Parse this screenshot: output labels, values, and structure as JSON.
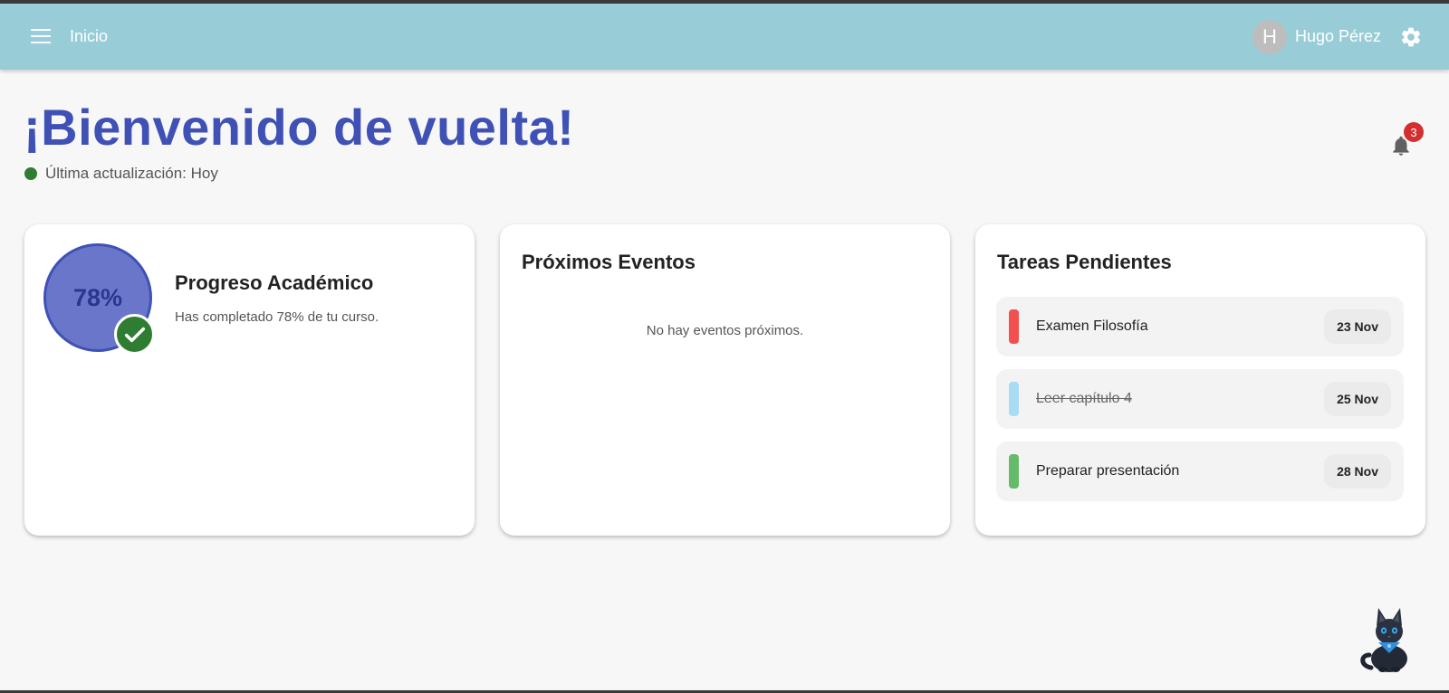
{
  "appbar": {
    "title": "Inicio",
    "user_initial": "H",
    "user_name": "Hugo Pérez",
    "color": "#98ccd7"
  },
  "header": {
    "welcome": "¡Bienvenido de vuelta!",
    "status_text": "Última actualización: Hoy",
    "status_color": "#2e7d32",
    "notification_count": "3"
  },
  "progress_card": {
    "percent_label": "78%",
    "percent_value": 78,
    "title": "Progreso Académico",
    "subtitle": "Has completado 78% de tu curso."
  },
  "events_card": {
    "title": "Próximos Eventos",
    "empty_text": "No hay eventos próximos."
  },
  "tasks_card": {
    "title": "Tareas Pendientes",
    "items": [
      {
        "label": "Examen Filosofía",
        "date": "23 Nov",
        "color": "#f44f4f",
        "done": false
      },
      {
        "label": "Leer capítulo 4",
        "date": "25 Nov",
        "color": "#a8dcf5",
        "done": true
      },
      {
        "label": "Preparar presentación",
        "date": "28 Nov",
        "color": "#66bb6a",
        "done": false
      }
    ]
  },
  "icons": {
    "menu": "menu-icon",
    "settings": "gear-icon",
    "notifications": "bell-icon",
    "check": "check-icon",
    "mascot": "cat-mascot-icon"
  }
}
